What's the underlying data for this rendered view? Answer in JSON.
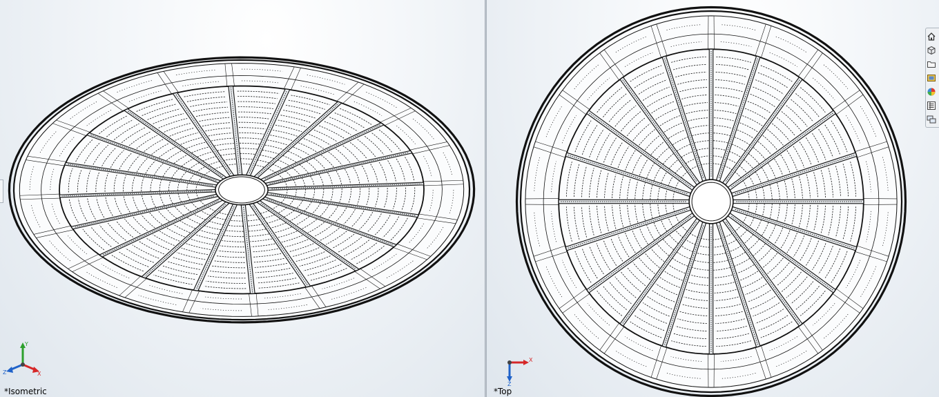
{
  "app": {
    "type": "CAD viewport (two panes)"
  },
  "viewports": [
    {
      "id": "left",
      "view_name": "*Isometric",
      "triad": {
        "axes": [
          "X",
          "Y",
          "Z"
        ]
      }
    },
    {
      "id": "right",
      "view_name": "*Top",
      "triad": {
        "axes": [
          "X",
          "Z"
        ]
      }
    }
  ],
  "model": {
    "radial_ribs": 20,
    "line_color": "#111111",
    "background_color": "#eef2f6"
  },
  "view_toolbar": {
    "items": [
      {
        "name": "home-icon",
        "icon": "house"
      },
      {
        "name": "cube-icon",
        "icon": "cube"
      },
      {
        "name": "folder-icon",
        "icon": "folder"
      },
      {
        "name": "scenes-icon",
        "icon": "picture"
      },
      {
        "name": "appearances-icon",
        "icon": "color-ball"
      },
      {
        "name": "list-icon",
        "icon": "list"
      },
      {
        "name": "display-manager-icon",
        "icon": "monitors"
      }
    ]
  }
}
